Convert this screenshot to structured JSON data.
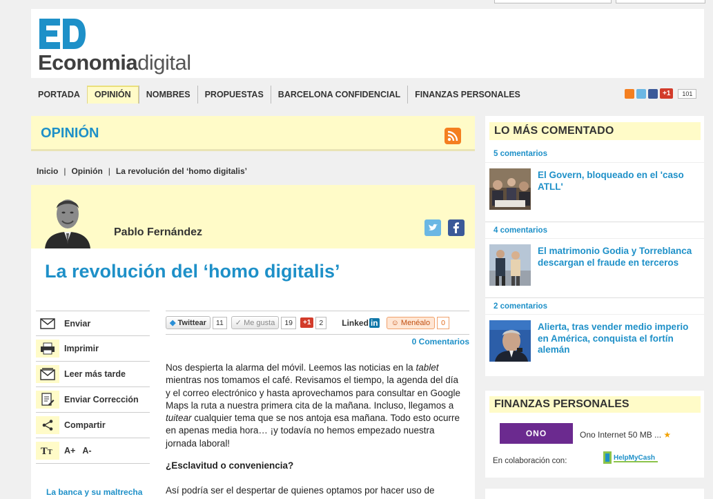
{
  "brand": {
    "logo_mark": "ED",
    "logo_bold": "Economia",
    "logo_light": "digital",
    "accent": "#1e90c8",
    "highlight": "#fffbc8"
  },
  "nav": {
    "items": [
      {
        "label": "PORTADA",
        "active": false
      },
      {
        "label": "OPINIÓN",
        "active": true
      },
      {
        "label": "NOMBRES",
        "active": false
      },
      {
        "label": "PROPUESTAS",
        "active": false
      },
      {
        "label": "BARCELONA CONFIDENCIAL",
        "active": false
      },
      {
        "label": "FINANZAS PERSONALES",
        "active": false
      }
    ],
    "social_icons": [
      "rss-icon",
      "twitter-icon",
      "facebook-icon",
      "google-plus-icon"
    ],
    "gplus_label": "+1",
    "gplus_count": "101"
  },
  "section": {
    "title": "OPINIÓN"
  },
  "breadcrumb": {
    "items": [
      "Inicio",
      "Opinión",
      "La revolución del ‘homo digitalis’"
    ],
    "separator": "|"
  },
  "article": {
    "author": "Pablo Fernández",
    "title": "La revolución del ‘homo digitalis’",
    "tools": [
      {
        "label": "Enviar",
        "icon": "envelope-icon"
      },
      {
        "label": "Imprimir",
        "icon": "printer-icon"
      },
      {
        "label": "Leer más tarde",
        "icon": "read-later-icon"
      },
      {
        "label": "Enviar Corrección",
        "icon": "correction-icon"
      },
      {
        "label": "Compartir",
        "icon": "share-icon"
      },
      {
        "label": "A+",
        "label2": "A-",
        "icon": "text-size-icon"
      }
    ],
    "related_link": "La banca y su maltrecha",
    "share": {
      "twitter_label": "Twittear",
      "twitter_count": "11",
      "like_label": "Me gusta",
      "like_count": "19",
      "gplus_label": "+1",
      "gplus_count": "2",
      "linkedin_label": "Linked",
      "linkedin_suffix": "in",
      "meneame_label": "Menéalo",
      "meneame_count": "0"
    },
    "comments_link": "0 Comentarios",
    "paragraph1_a": "Nos despierta la alarma del móvil. Leemos las noticias en la ",
    "paragraph1_em1": "tablet",
    "paragraph1_b": " mientras nos tomamos el café. Revisamos el tiempo, la agenda del día y el correo electrónico y hasta aprovechamos para consultar en Google Maps la ruta a nuestra primera cita de la mañana. Incluso, llegamos a ",
    "paragraph1_em2": "tuitear",
    "paragraph1_c": " cualquier tema que se nos antoja esa mañana. Todo esto ocurre en apenas media hora… ¡y todavía no hemos empezado nuestra jornada laboral!",
    "subheading": "¿Esclavitud o conveniencia?",
    "paragraph2": "Así podría ser el despertar de quienes optamos por hacer uso de"
  },
  "sidebar": {
    "most_commented_title": "LO MÁS COMENTADO",
    "items": [
      {
        "comments": "5 comentarios",
        "title": "El Govern, bloqueado en el 'caso ATLL'"
      },
      {
        "comments": "4 comentarios",
        "title": "El matrimonio Godia y Torreblanca descargan el fraude en terceros"
      },
      {
        "comments": "2 comentarios",
        "title": "Alierta, tras vender medio imperio en América, conquista el fortín alemán"
      }
    ],
    "finanzas_title": "FINANZAS PERSONALES",
    "ono_logo": "ONO",
    "ono_text": "Ono Internet 50 MB ...",
    "ono_star": "★",
    "collab_label": "En colaboración con:",
    "partner": "HelpMyCash"
  }
}
